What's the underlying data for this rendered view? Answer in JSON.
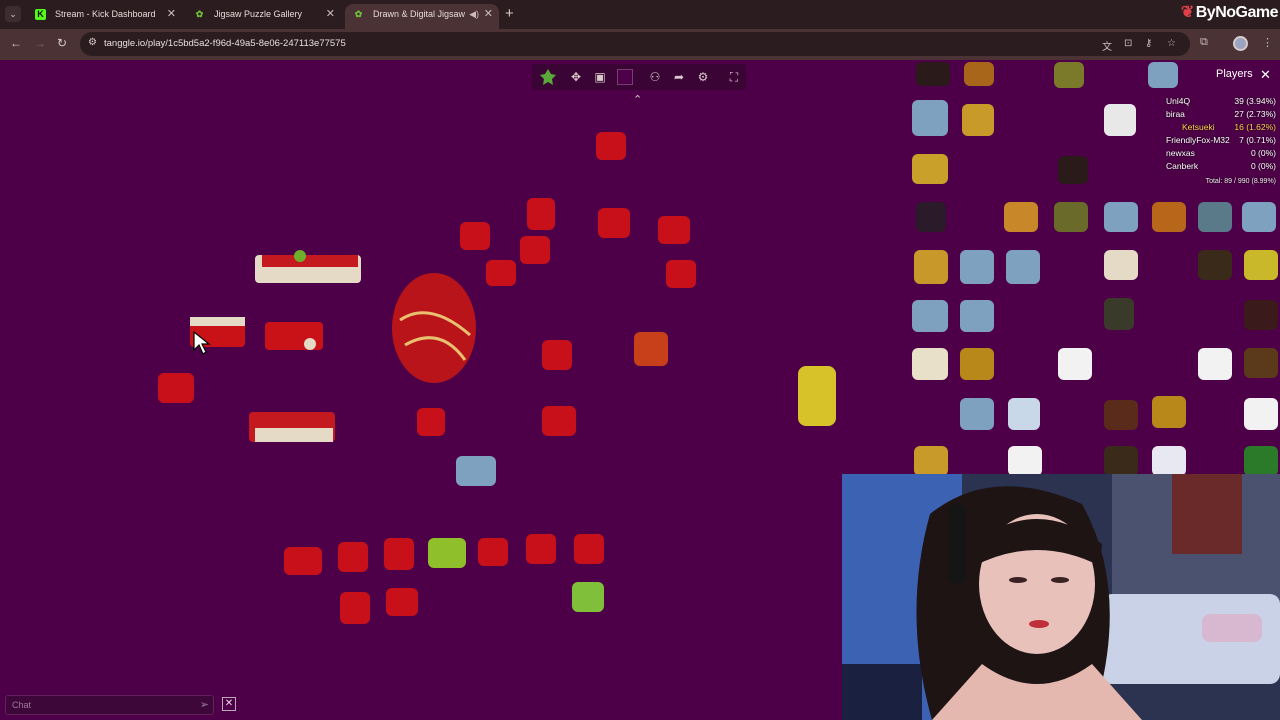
{
  "browser": {
    "tabs": [
      {
        "title": "Stream - Kick Dashboard",
        "favicon": "kick-icon",
        "active": false
      },
      {
        "title": "Jigsaw Puzzle Gallery",
        "favicon": "tanggle-icon",
        "active": false
      },
      {
        "title": "Drawn & Digital Jigsaw",
        "favicon": "tanggle-icon",
        "active": true
      }
    ],
    "url": "tanggle.io/play/1c5bd5a2-f96d-49a5-8e06-247113e77575",
    "brand": "ByNoGame"
  },
  "game": {
    "players_title": "Players",
    "players": [
      {
        "name": "Unl4Q",
        "score": "39 (3.94%)"
      },
      {
        "name": "biraa",
        "score": "27 (2.73%)"
      },
      {
        "name": "Ketsueki",
        "score": "16 (1.62%)"
      },
      {
        "name": "FriendlyFox-M32",
        "score": "7 (0.71%)"
      },
      {
        "name": "newxas",
        "score": "0 (0%)"
      },
      {
        "name": "Canberk",
        "score": "0 (0%)"
      }
    ],
    "total": "Total: 89 / 990 (8.99%)",
    "chat_placeholder": "Chat"
  },
  "colors": {
    "background": "#4d0047",
    "piece_red": "#c8101a",
    "piece_cream": "#e8dcc8",
    "piece_gold": "#d8c22a",
    "piece_blue": "#7ea1c0",
    "piece_white": "#f2f2f2"
  }
}
